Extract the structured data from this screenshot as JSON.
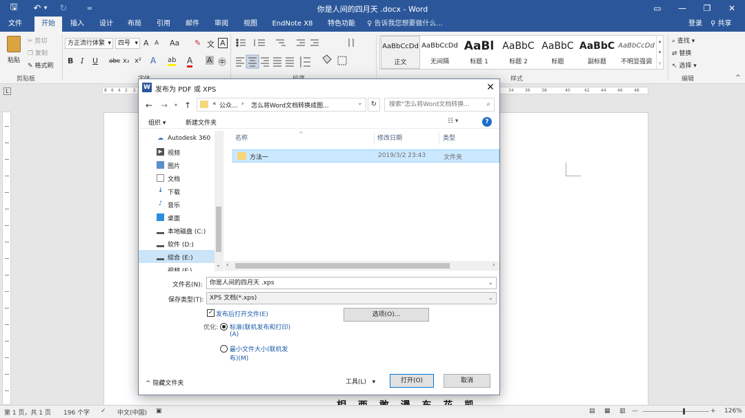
{
  "app": {
    "title": "你是人间的四月天 .docx - Word",
    "quick_access": {
      "save": "🖫",
      "undo": "↶",
      "undo_dd": "▾",
      "redo": "↻",
      "customize": "="
    },
    "window_controls": {
      "ribbon_display": "▭",
      "minimize": "—",
      "maximize": "❐",
      "close": "✕"
    }
  },
  "tabs": {
    "items": [
      "文件",
      "开始",
      "插入",
      "设计",
      "布局",
      "引用",
      "邮件",
      "审阅",
      "视图",
      "EndNote X8",
      "特色功能"
    ],
    "tell_me": "告诉我您想要做什么...",
    "login": "登录",
    "share": "共享"
  },
  "ribbon": {
    "clipboard": {
      "paste": "粘贴",
      "cut": "剪切",
      "copy": "复制",
      "format_painter": "格式刷",
      "group": "剪贴板"
    },
    "font": {
      "name": "方正流行体繁",
      "size": "四号",
      "grow": "A",
      "shrink": "A",
      "case": "Aa",
      "clear": "✎",
      "pinyin": "文",
      "border": "A",
      "bold": "B",
      "italic": "I",
      "underline": "U",
      "strike": "abc",
      "sub": "x₂",
      "sup": "x²",
      "effects": "A",
      "highlight": "ab",
      "color": "A",
      "shade": "A",
      "enclose": "㊥",
      "group": "字体"
    },
    "paragraph": {
      "group": "段落"
    },
    "styles": {
      "items": [
        {
          "preview": "AaBbCcDd",
          "name": "正文"
        },
        {
          "preview": "AaBbCcDd",
          "name": "无间隔"
        },
        {
          "preview": "AaBl",
          "name": "标题 1"
        },
        {
          "preview": "AaBbC",
          "name": "标题 2"
        },
        {
          "preview": "AaBbC",
          "name": "标题"
        },
        {
          "preview": "AaBbC",
          "name": "副标题"
        },
        {
          "preview": "AaBbCcDd",
          "name": "不明显强调"
        }
      ],
      "group": "样式"
    },
    "editing": {
      "find": "查找",
      "replace": "替换",
      "select": "选择",
      "group": "编辑"
    }
  },
  "ruler": {
    "ticks": [
      "8",
      "6",
      "4",
      "2",
      "2",
      "4",
      "6",
      "8",
      "10",
      "34",
      "36",
      "38",
      "40",
      "42",
      "44",
      "46",
      "48"
    ],
    "corner": "L"
  },
  "document": {
    "visible_text": "相 西 敢 漫 东 花 凯"
  },
  "status": {
    "page": "第 1 页，共 1 页",
    "words": "196 个字",
    "lang": "中文(中国)",
    "zoom": "126%"
  },
  "dialog": {
    "title": "发布为 PDF 或 XPS",
    "address": {
      "prefix": "«",
      "seg1": "公众...",
      "sep": "›",
      "seg2": "怎么将Word文档转换成图..."
    },
    "search_placeholder": "搜索\"怎么将Word文档转换...",
    "organize": "组织 ▾",
    "new_folder": "新建文件夹",
    "nav": [
      "Autodesk 360",
      "视频",
      "图片",
      "文档",
      "下载",
      "音乐",
      "桌面",
      "本地磁盘 (C:)",
      "软件 (D:)",
      "综合 (E:)",
      "视频 (F:)"
    ],
    "columns": {
      "name": "名称",
      "date": "修改日期",
      "type": "类型"
    },
    "files": [
      {
        "name": "方法一",
        "date": "2019/3/2 23:43",
        "type": "文件夹"
      }
    ],
    "filename_label": "文件名(N):",
    "filename": "你是人间的四月天 .xps",
    "type_label": "保存类型(T):",
    "type_value": "XPS 文档(*.xps)",
    "open_after": "发布后打开文件(E)",
    "optimize_label": "优化:",
    "opt1": "标准(联机发布和打印)",
    "opt1_b": "(A)",
    "opt2": "最小文件大小(联机发",
    "opt2_b": "布)(M)",
    "options_button": "选项(O)...",
    "hide_folders": "隐藏文件夹",
    "tools": "工具(L)",
    "open_button": "打开(O)",
    "cancel_button": "取消"
  }
}
